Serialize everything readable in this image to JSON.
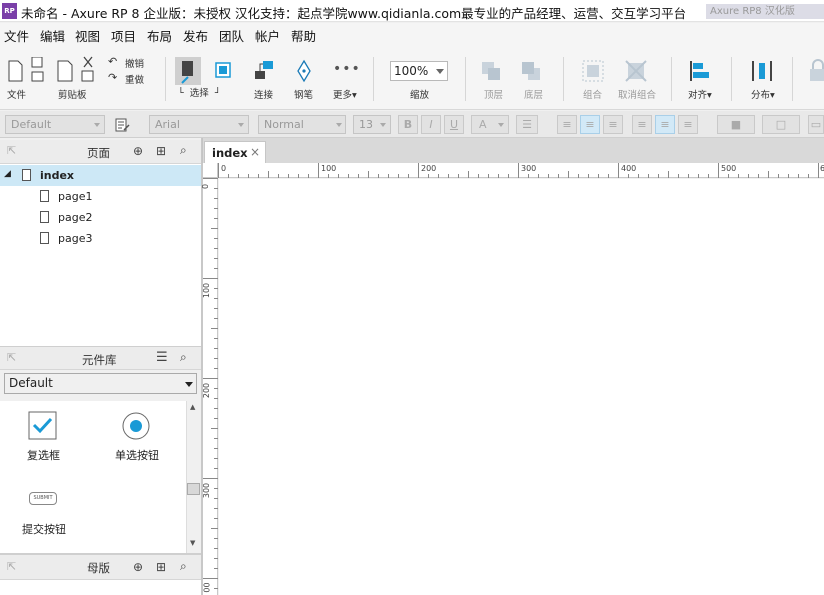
{
  "window": {
    "title": "未命名 - Axure RP 8 企业版：未授权 汉化支持：起点学院www.qidianla.com最专业的产品经理、运营、交互学习平台",
    "logo": "RP",
    "right_window_text": "Axure RP8 汉化版"
  },
  "menu": [
    "文件",
    "编辑",
    "视图",
    "项目",
    "布局",
    "发布",
    "团队",
    "帐户",
    "帮助"
  ],
  "toolbar": {
    "file": "文件",
    "clipboard": "剪贴板",
    "undo": "撤销",
    "redo": "重做",
    "select": "选择",
    "connect": "连接",
    "pen": "钢笔",
    "more": "更多▾",
    "zoom_value": "100%",
    "zoom": "缩放",
    "top": "顶层",
    "bottom": "底层",
    "group": "组合",
    "ungroup": "取消组合",
    "align": "对齐▾",
    "distribute": "分布▾"
  },
  "format": {
    "style": "Default",
    "font": "Arial",
    "weight": "Normal",
    "size": "13",
    "bold": "B",
    "italic": "I",
    "underline": "U",
    "color": "A"
  },
  "pages_panel": {
    "title": "页面",
    "root": "index",
    "pages": [
      "page1",
      "page2",
      "page3"
    ]
  },
  "library_panel": {
    "title": "元件库",
    "selected_library": "Default",
    "widgets": [
      "复选框",
      "单选按钮",
      "提交按钮"
    ],
    "submit_icon_text": "SUBMIT"
  },
  "masters_panel": {
    "title": "母版"
  },
  "canvas": {
    "tab": "index",
    "tab_close": "×",
    "ruler_h": [
      "0",
      "100",
      "200",
      "300",
      "400",
      "500",
      "6"
    ],
    "ruler_v": [
      "0",
      "100",
      "200",
      "300",
      "00"
    ]
  },
  "colors": {
    "accent": "#1a9ad6",
    "selection": "#cde8f6",
    "toolbar": "#f5f5f5"
  }
}
